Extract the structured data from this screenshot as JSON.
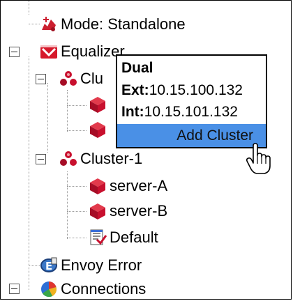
{
  "tree": {
    "mode_label": "Mode: Standalone",
    "equalizer_label": "Equalizer",
    "cluster_partial_label": "Clu",
    "cluster1_label": "Cluster-1",
    "server_a_label": "server-A",
    "server_b_label": "server-B",
    "default_label": "Default",
    "envoy_label": "Envoy Error",
    "connections_label": "Connections"
  },
  "popup": {
    "title": "Dual",
    "ext_key": "Ext:",
    "ext_value": "10.15.100.132",
    "int_key": "Int:",
    "int_value": "10.15.101.132",
    "add_cluster_label": "Add Cluster"
  },
  "icons": {
    "mode": "mode-icon",
    "equalizer": "equalizer-icon",
    "cluster": "cluster-icon",
    "server": "server-icon",
    "default": "default-policy-icon",
    "envoy": "envoy-icon",
    "connections": "connections-icon",
    "expander": "collapse-toggle",
    "pointer": "hand-pointer-cursor"
  },
  "colors": {
    "highlight": "#4a90e6",
    "server_red": "#c8102e",
    "equalizer_red": "#d6192b"
  }
}
